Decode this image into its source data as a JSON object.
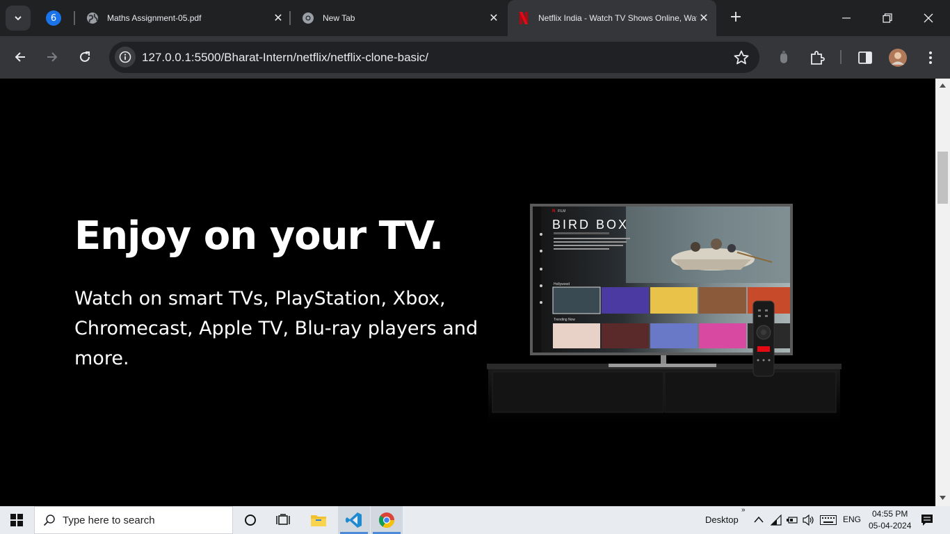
{
  "browser": {
    "tab_group_count": "6",
    "tabs": [
      {
        "title": "Maths Assignment-05.pdf",
        "icon": "globe-icon"
      },
      {
        "title": "New Tab",
        "icon": "chrome-icon"
      },
      {
        "title": "Netflix India - Watch TV Shows Online, Watch Movies Online",
        "icon": "netflix-icon"
      }
    ],
    "url": "127.0.0.1:5500/Bharat-Intern/netflix/netflix-clone-basic/"
  },
  "page": {
    "heading": "Enjoy on your TV.",
    "subheading": "Watch on smart TVs, PlayStation, Xbox, Chromecast, Apple TV, Blu-ray players and more.",
    "tv_screen": {
      "brand": "FILM",
      "title": "BIRD BOX",
      "row1_label": "Hollywood",
      "row2_label": "Trending Now"
    }
  },
  "taskbar": {
    "search_placeholder": "Type here to search",
    "desktop_label": "Desktop",
    "language": "ENG",
    "time": "04:55 PM",
    "date": "05-04-2024"
  },
  "colors": {
    "accent_blue": "#1a73e8",
    "netflix_red": "#e50914",
    "chrome_dark": "#1f2123",
    "toolbar": "#35363a"
  }
}
